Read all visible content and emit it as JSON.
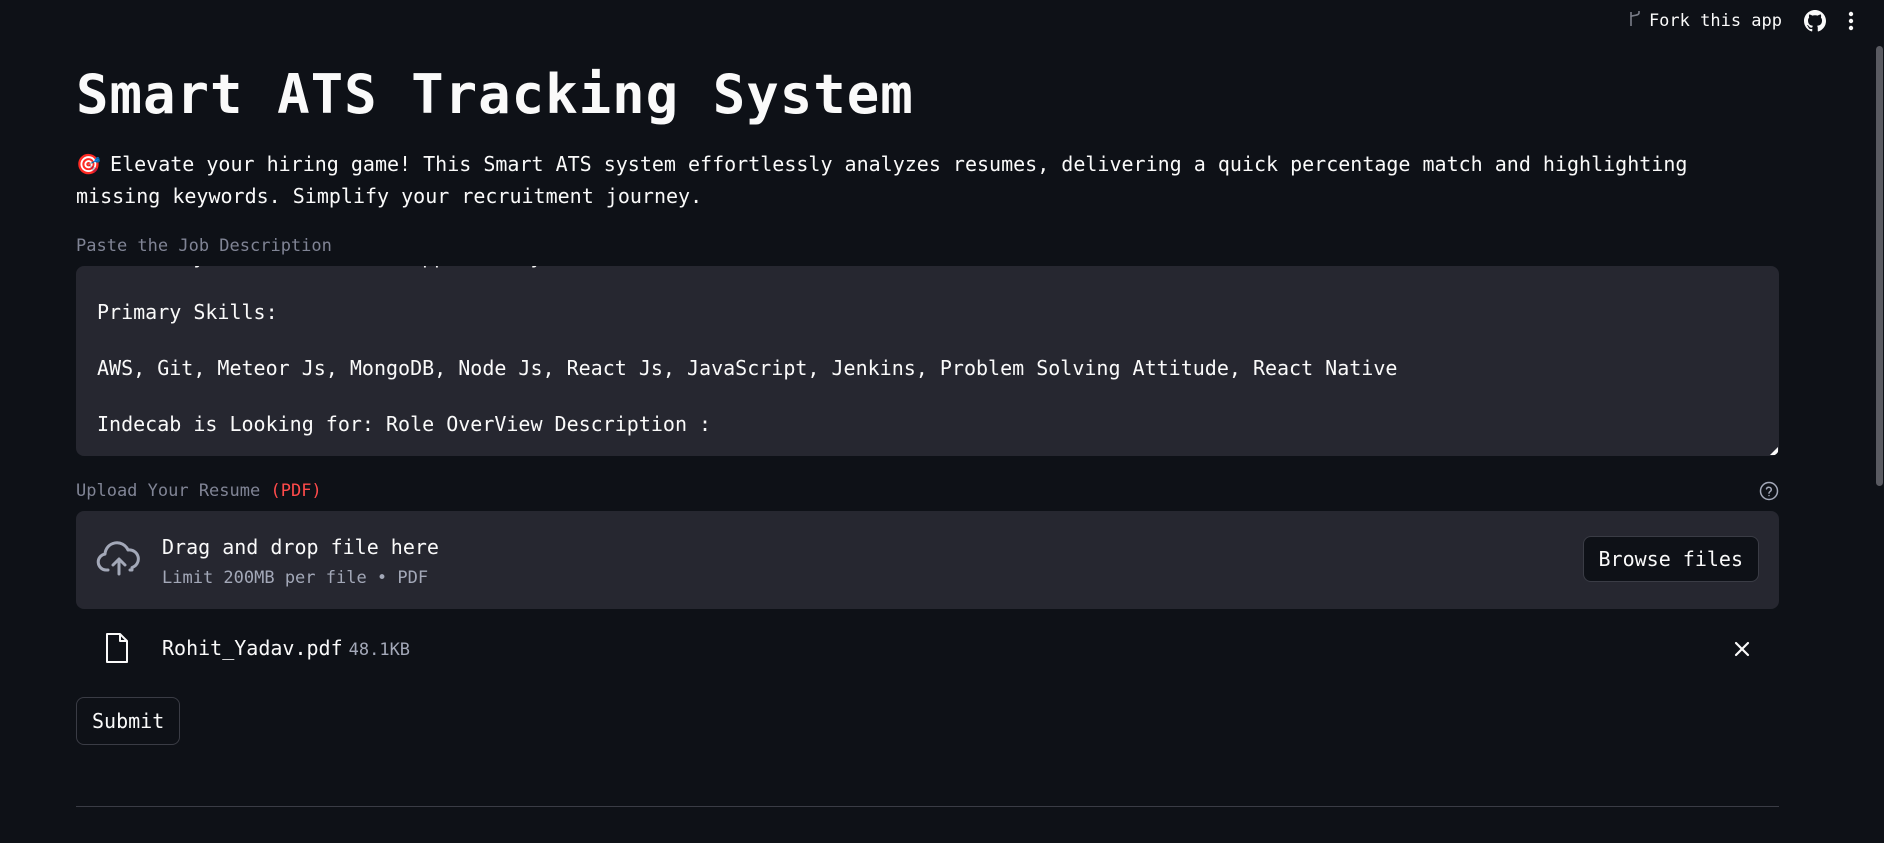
{
  "toolbar": {
    "fork_label": "Fork this app",
    "fork_icon": "fork-icon",
    "github_icon": "github-icon",
    "menu_icon": "kebab-menu-icon"
  },
  "header": {
    "title": "Smart ATS Tracking System",
    "description_emoji": "🎯",
    "description": "Elevate your hiring game! This Smart ATS system effortlessly analyzes resumes, delivering a quick percentage match and highlighting missing keywords. Simplify your recruitment journey."
  },
  "job_description": {
    "label": "Paste the Job Description",
    "lines": [
      "What do you need for this opportunity?",
      "",
      "Primary Skills:",
      "",
      "AWS, Git, Meteor Js, MongoDB, Node Js, React Js, JavaScript, Jenkins, Problem Solving Attitude, React Native",
      "",
      "Indecab is Looking for: Role OverView Description :"
    ]
  },
  "uploader": {
    "label": "Upload Your Resume",
    "label_suffix": "(PDF)",
    "help_icon": "help-circle-icon",
    "upload_icon": "cloud-upload-icon",
    "dropzone_title": "Drag and drop file here",
    "dropzone_subtitle": "Limit 200MB per file • PDF",
    "browse_label": "Browse files"
  },
  "uploaded_file": {
    "icon": "file-icon",
    "name": "Rohit_Yadav.pdf",
    "size": "48.1KB",
    "remove_icon": "close-icon"
  },
  "actions": {
    "submit_label": "Submit"
  },
  "colors": {
    "background": "#0e1117",
    "surface": "#262730",
    "text": "#fafafa",
    "muted": "#808495",
    "accent_red": "#ff4b4b"
  }
}
